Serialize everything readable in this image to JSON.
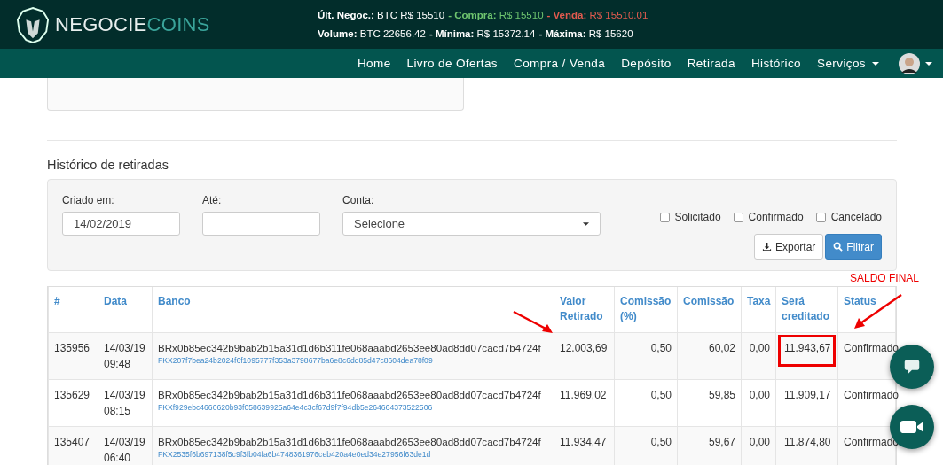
{
  "header": {
    "brand": {
      "part1": "NEGOCIE",
      "part2": "COINS"
    },
    "ticker_line1": [
      {
        "label": "Últ. Negoc.:",
        "value": "BTC R$ 15510",
        "color": "#ffffff"
      },
      {
        "label": "- Compra:",
        "value": "R$ 15510",
        "color": "#6fc56f"
      },
      {
        "label": "- Venda:",
        "value": "R$ 15510.01",
        "color": "#e25b4f"
      }
    ],
    "ticker_line2": [
      {
        "label": "Volume:",
        "value": "BTC 22656.42",
        "color": "#ffffff"
      },
      {
        "label": "- Mínima:",
        "value": "R$ 15372.14",
        "color": "#ffffff"
      },
      {
        "label": "- Máxima:",
        "value": "R$ 15620",
        "color": "#ffffff"
      }
    ]
  },
  "nav": {
    "items": [
      {
        "label": "Home",
        "dropdown": false
      },
      {
        "label": "Livro de Ofertas",
        "dropdown": false
      },
      {
        "label": "Compra / Venda",
        "dropdown": false
      },
      {
        "label": "Depósito",
        "dropdown": false
      },
      {
        "label": "Retirada",
        "dropdown": false
      },
      {
        "label": "Histórico",
        "dropdown": false
      },
      {
        "label": "Serviços",
        "dropdown": true
      }
    ]
  },
  "section_title": "Histórico de retiradas",
  "filters": {
    "created": {
      "label": "Criado em:",
      "value": "14/02/2019"
    },
    "until": {
      "label": "Até:"
    },
    "account": {
      "label": "Conta:",
      "value": "Selecione"
    },
    "statuses": [
      {
        "label": "Solicitado",
        "checked": false
      },
      {
        "label": "Confirmado",
        "checked": false
      },
      {
        "label": "Cancelado",
        "checked": false
      }
    ],
    "buttons": [
      {
        "label": "Exportar",
        "kind": "export"
      },
      {
        "label": "Filtrar",
        "kind": "filter"
      }
    ]
  },
  "table": {
    "columns": [
      "#",
      "Data",
      "Banco",
      "Valor Retirado",
      "Comissão (%)",
      "Comissão",
      "Taxa",
      "Será creditado",
      "Status"
    ],
    "rows": [
      {
        "id": "135956",
        "date": "14/03/19",
        "time": "09:48",
        "bank": "BRx0b85ec342b9bab2b15a31d1d6b311fe068aaabd2653ee80ad8dd07cacd7b4724f",
        "ref": "FKX207f7bea24b2024f6f1095777f353a3798677ba6e8c6dd85d47c8604dea78f09",
        "value": "12.003,69",
        "fee_pct": "0,50",
        "fee": "60,02",
        "tax": "0,00",
        "credited": "11.943,67",
        "status": "Confirmado",
        "highlighted": true
      },
      {
        "id": "135629",
        "date": "14/03/19",
        "time": "08:15",
        "bank": "BRx0b85ec342b9bab2b15a31d1d6b311fe068aaabd2653ee80ad8dd07cacd7b4724f",
        "ref": "FKXf929ebc4660620b93f058639925a64e4c3cf67d9f7f94db5e264664373522506",
        "value": "11.969,02",
        "fee_pct": "0,50",
        "fee": "59,85",
        "tax": "0,00",
        "credited": "11.909,17",
        "status": "Confirmado",
        "highlighted": false
      },
      {
        "id": "135407",
        "date": "14/03/19",
        "time": "06:40",
        "bank": "BRx0b85ec342b9bab2b15a31d1d6b311fe068aaabd2653ee80ad8dd07cacd7b4724f",
        "ref": "FKX2535f6b697138f5c9f3fb04fa6b4748361976ceb420a4e0ed34e27956f63de1d",
        "value": "11.934,47",
        "fee_pct": "0,50",
        "fee": "59,67",
        "tax": "0,00",
        "credited": "11.874,80",
        "status": "Confirmado",
        "highlighted": false
      }
    ]
  },
  "annotation": {
    "label": "SALDO FINAL"
  }
}
